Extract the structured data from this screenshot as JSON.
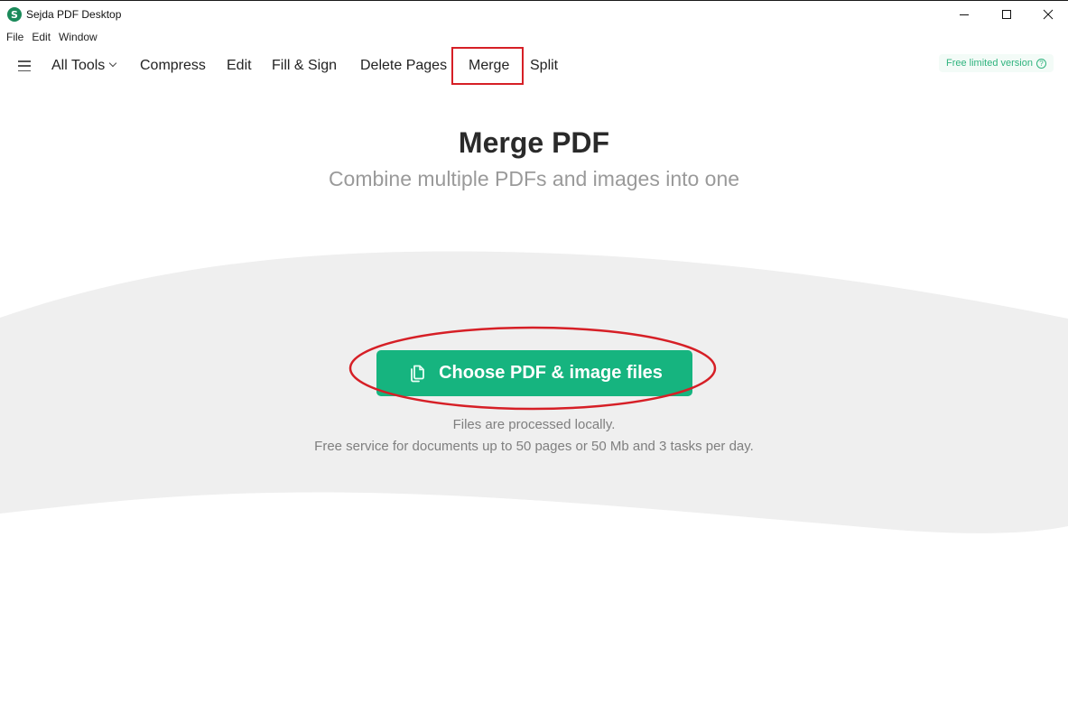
{
  "window": {
    "title": "Sejda PDF Desktop",
    "logo_letter": "S",
    "controls": {
      "minimize": "minimize",
      "maximize": "maximize",
      "close": "close"
    }
  },
  "menubar": {
    "items": [
      "File",
      "Edit",
      "Window"
    ]
  },
  "toolbar": {
    "menu_icon": "hamburger-icon",
    "items": [
      {
        "label": "All Tools",
        "has_dropdown": true
      },
      {
        "label": "Compress"
      },
      {
        "label": "Edit"
      },
      {
        "label": "Fill & Sign"
      },
      {
        "label": "Delete Pages"
      },
      {
        "label": "Merge",
        "highlighted": true
      },
      {
        "label": "Split"
      }
    ],
    "badge": {
      "label": "Free limited version",
      "icon": "help-icon"
    }
  },
  "hero": {
    "title": "Merge PDF",
    "subtitle": "Combine multiple PDFs and images into one"
  },
  "upload": {
    "button_label": "Choose PDF & image files",
    "button_icon": "files-icon",
    "note_1": "Files are processed locally.",
    "note_2": "Free service for documents up to 50 pages or 50 Mb and 3 tasks per day."
  },
  "colors": {
    "brand_green": "#16b47f",
    "badge_green": "#2fb37e",
    "annotation_red": "#d61f26",
    "wave_gray": "#efefef"
  }
}
